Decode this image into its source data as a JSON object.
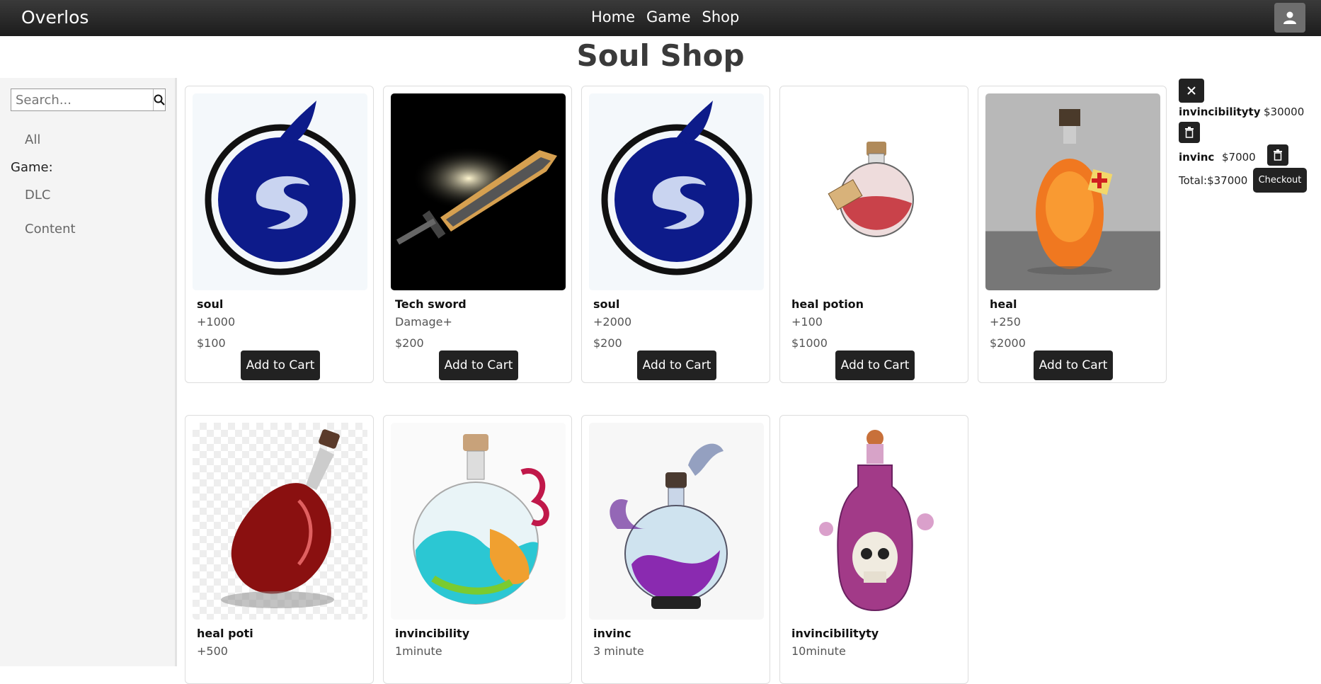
{
  "navbar": {
    "brand": "Overlos",
    "links": [
      "Home",
      "Game",
      "Shop"
    ],
    "user_icon": "user-icon"
  },
  "page": {
    "title": "Soul Shop"
  },
  "sidebar": {
    "search_placeholder": "Search...",
    "search_icon": "search-icon",
    "all_label": "All",
    "game_heading": "Game:",
    "items": [
      "DLC",
      "Content"
    ]
  },
  "products": [
    {
      "name": "soul",
      "desc": "+1000",
      "price": "$100",
      "button": "Add to Cart",
      "image": "soul-logo"
    },
    {
      "name": "Tech sword",
      "desc": "Damage+",
      "price": "$200",
      "button": "Add to Cart",
      "image": "glowing-sword"
    },
    {
      "name": "soul",
      "desc": "+2000",
      "price": "$200",
      "button": "Add to Cart",
      "image": "soul-logo"
    },
    {
      "name": "heal potion",
      "desc": "+100",
      "price": "$1000",
      "button": "Add to Cart",
      "image": "red-potion-flask"
    },
    {
      "name": "heal",
      "desc": "+250",
      "price": "$2000",
      "button": "Add to Cart",
      "image": "orange-heal-potion"
    },
    {
      "name": "heal poti",
      "desc": "+500",
      "image": "tilted-red-potion"
    },
    {
      "name": "invincibility",
      "desc": "1minute",
      "image": "rainbow-potion"
    },
    {
      "name": "invinc",
      "desc": "3 minute",
      "image": "purple-smoke-potion"
    },
    {
      "name": "invincibilityty",
      "desc": "10minute",
      "image": "skull-potion"
    }
  ],
  "cart": {
    "close_icon": "close-icon",
    "items": [
      {
        "name": "invincibilityty",
        "price": "$30000"
      },
      {
        "name": "invinc",
        "price": "$7000"
      }
    ],
    "total": "Total:$37000",
    "checkout_label": "Checkout"
  },
  "colors": {
    "navbar": "#2a2a2a",
    "button": "#222222",
    "sidebar": "#f4f4f4",
    "soul_blue": "#0d1b8a"
  }
}
